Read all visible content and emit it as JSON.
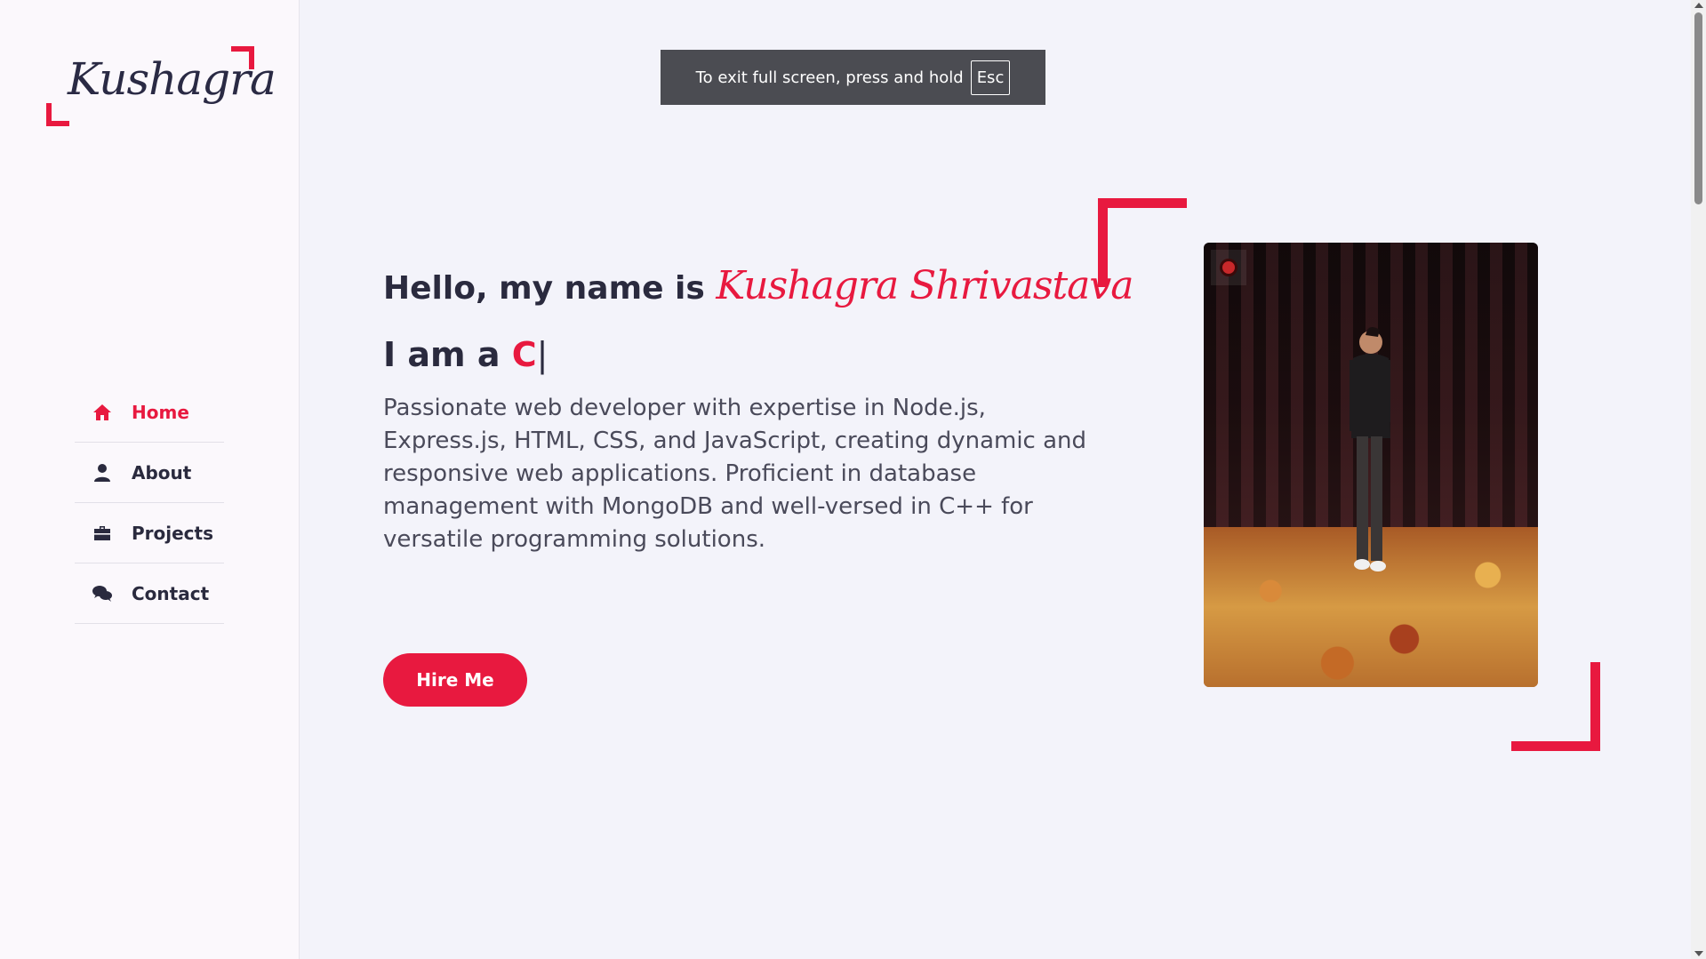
{
  "sidebar": {
    "logo_text": "Kushagra",
    "nav": [
      {
        "label": "Home",
        "icon": "home-icon",
        "active": true
      },
      {
        "label": "About",
        "icon": "user-icon",
        "active": false
      },
      {
        "label": "Projects",
        "icon": "briefcase-icon",
        "active": false
      },
      {
        "label": "Contact",
        "icon": "comments-icon",
        "active": false
      }
    ]
  },
  "fullscreen_toast": {
    "text": "To exit full screen, press and hold",
    "key": "Esc"
  },
  "hero": {
    "greeting_prefix": "Hello, my name is",
    "name": "Kushagra Shrivastava",
    "iam_prefix": "I am a",
    "typed_text": "C",
    "cursor": "|",
    "description": "Passionate web developer with expertise in Node.js, Express.js, HTML, CSS, and JavaScript, creating dynamic and responsive web applications. Proficient in database management with MongoDB and well-versed in C++ for versatile programming solutions.",
    "cta_label": "Hire Me"
  },
  "colors": {
    "accent": "#e8193f",
    "text_dark": "#2a2a3e",
    "background": "#f3f3fa",
    "sidebar_bg": "#fbf8fc"
  }
}
